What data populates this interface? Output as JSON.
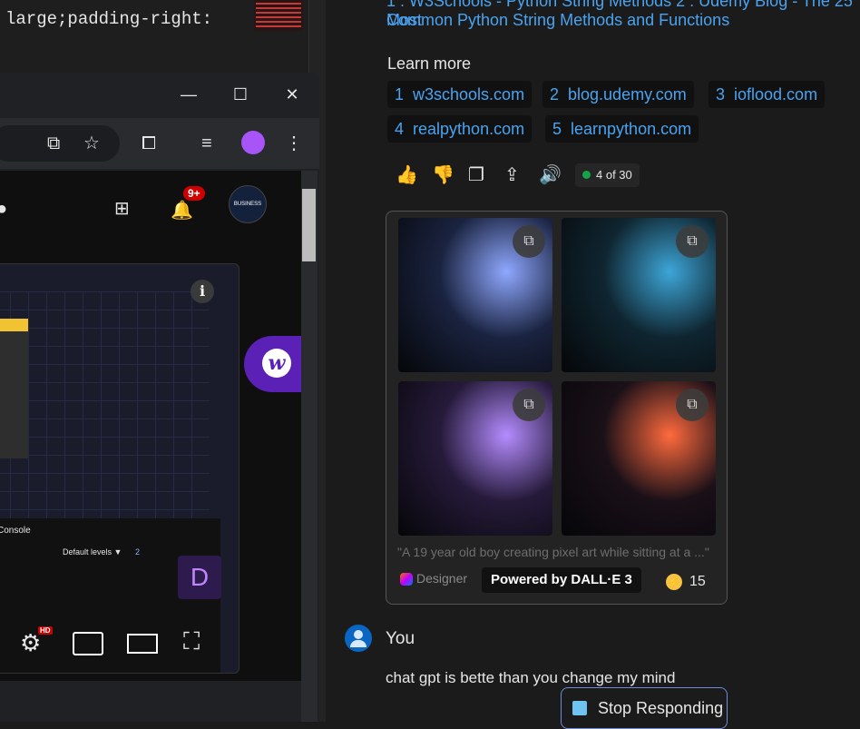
{
  "editor": {
    "code_text": "large;padding-right:"
  },
  "browser": {
    "window_controls": {
      "minimize": "—",
      "maximize": "☐",
      "close": "✕"
    },
    "notification_badge": "9+",
    "channel_avatar_text": "BUSINESS",
    "devtools": {
      "console_tab": "Console",
      "levels": "Default levels ▼",
      "issues_count": "2"
    },
    "video_player": {
      "hd_badge": "HD"
    }
  },
  "chat": {
    "citations": {
      "line1": "1 : W3Schools - Python String Methods 2 : Udemy Blog - The 25 Most",
      "line2": "Common Python String Methods and Functions"
    },
    "learn_more": {
      "label": "Learn more",
      "links": [
        {
          "num": "1",
          "text": "w3schools.com"
        },
        {
          "num": "2",
          "text": "blog.udemy.com"
        },
        {
          "num": "3",
          "text": "ioflood.com"
        },
        {
          "num": "4",
          "text": "realpython.com"
        },
        {
          "num": "5",
          "text": "learnpython.com"
        }
      ]
    },
    "actions": {
      "counter": "4 of 30"
    },
    "image_card": {
      "caption": "\"A 19 year old boy creating pixel art while sitting at a ...\"",
      "designer": "Designer",
      "powered_by": "Powered by DALL·E 3",
      "boosts": "15",
      "images": [
        {
          "bg": "#1a2340",
          "accent": "#8fa8ff"
        },
        {
          "bg": "#0f2530",
          "accent": "#3da6d8"
        },
        {
          "bg": "#261a3a",
          "accent": "#b48cff"
        },
        {
          "bg": "#1a1018",
          "accent": "#ff6a3d"
        }
      ]
    },
    "user": {
      "label": "You",
      "message": "chat gpt is bette than you change my mind"
    },
    "stop_button": "Stop Responding"
  }
}
